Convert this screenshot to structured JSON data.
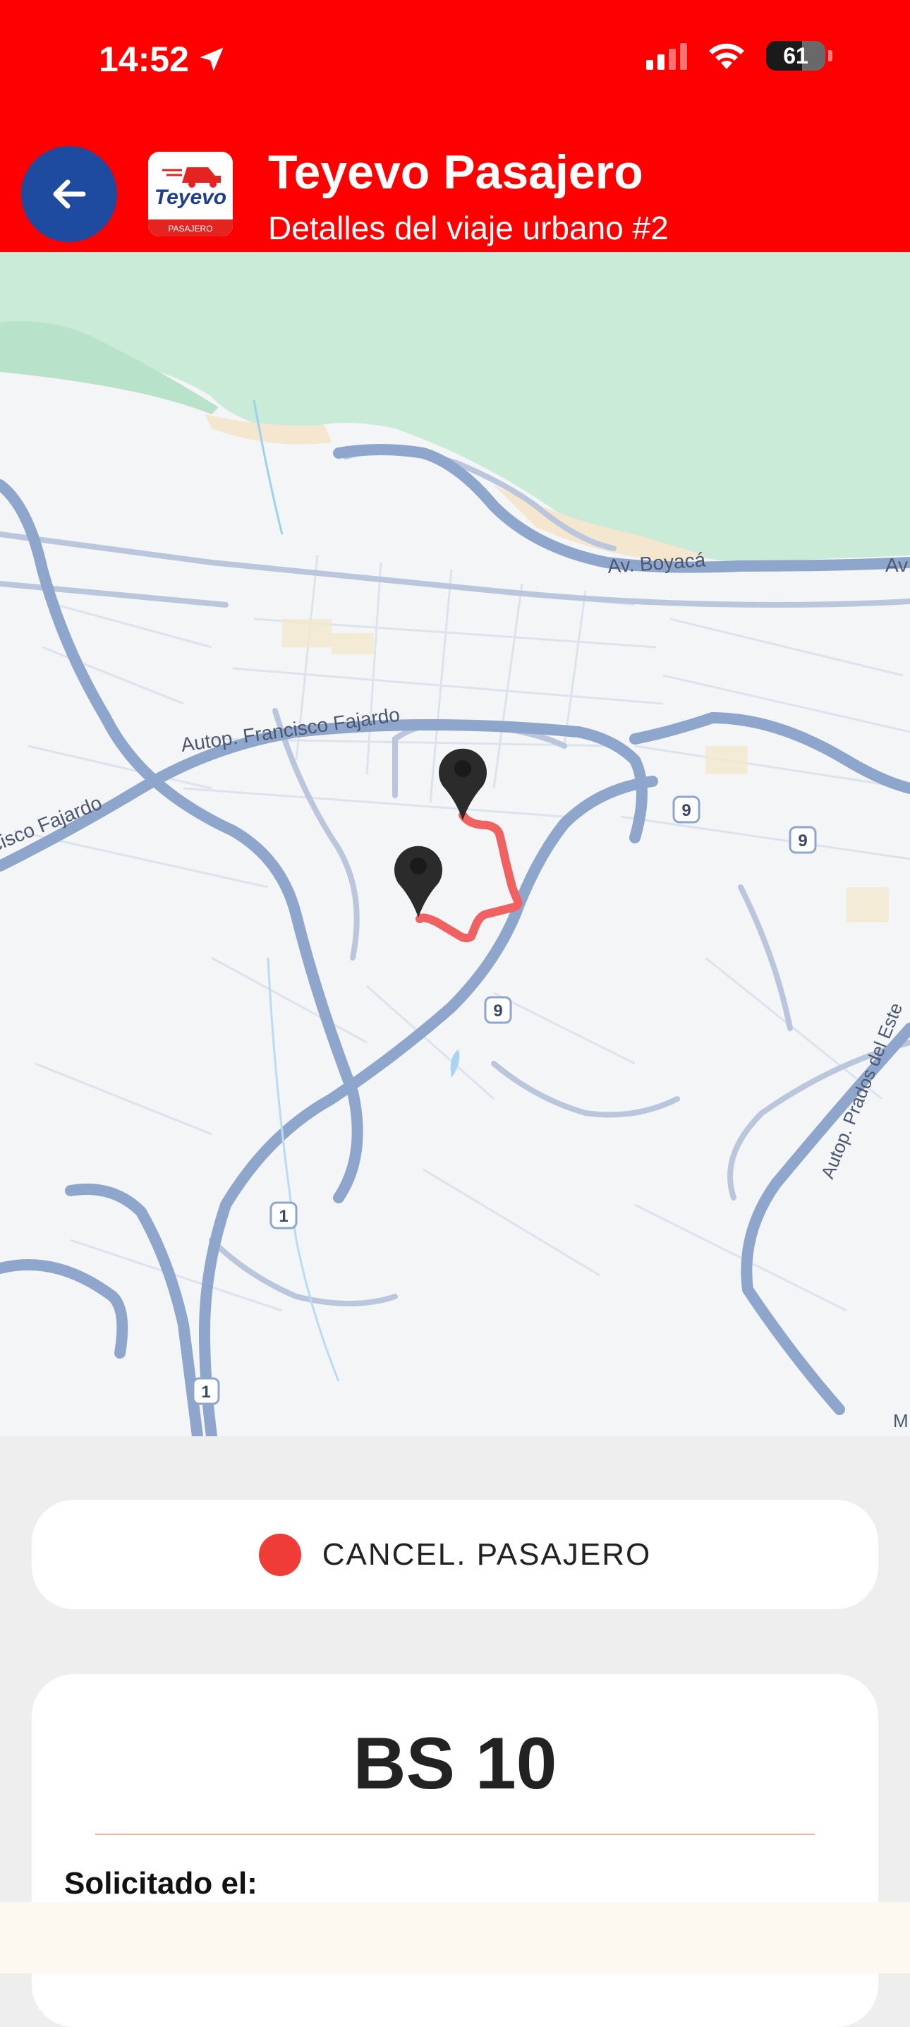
{
  "status_bar": {
    "time": "14:52",
    "battery": "61"
  },
  "header": {
    "title": "Teyevo Pasajero",
    "subtitle": "Detalles del viaje urbano #2",
    "logo_text": "Teyevo",
    "logo_tag": "PASAJERO"
  },
  "map": {
    "labels": {
      "boyaca": "Av. Boyacá",
      "av_edge": "Av",
      "fajardo_main": "Autop. Francisco Fajardo",
      "fajardo_left": "cisco Fajardo",
      "prados": "Autop. Prados del Este",
      "route_9": "9",
      "route_1": "1",
      "edge_m": "M"
    },
    "route_color": "#f06262",
    "marker_color": "#2b2b2b"
  },
  "trip": {
    "status": "CANCEL. PASAJERO",
    "status_color": "#f03c36",
    "price": "BS 10",
    "requested_label": "Solicitado el:"
  }
}
